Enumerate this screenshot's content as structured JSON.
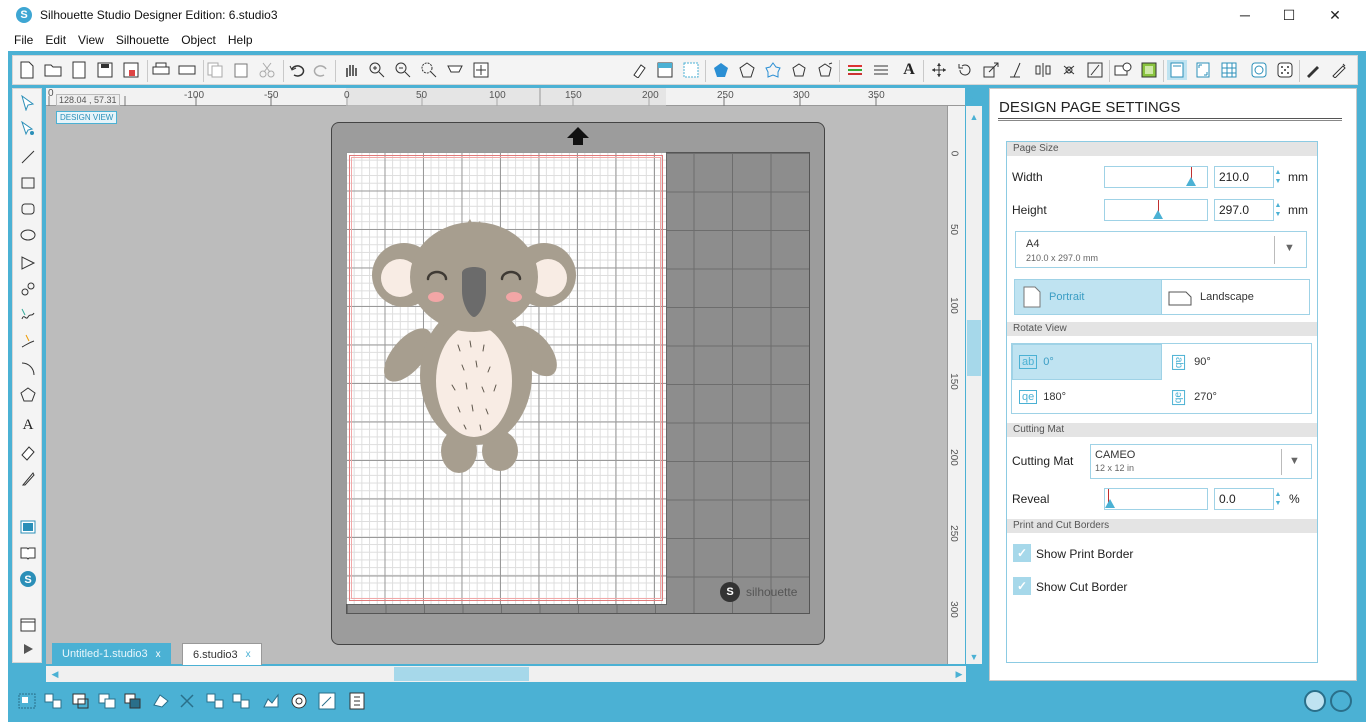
{
  "window": {
    "title": "Silhouette Studio Designer Edition: 6.studio3",
    "logo_letter": "S",
    "minimize": "─",
    "maximize": "☐",
    "close": "✕"
  },
  "menu": [
    "File",
    "Edit",
    "View",
    "Silhouette",
    "Object",
    "Help"
  ],
  "ruler": {
    "coords": "128.04 , 57.31",
    "h_ticks": [
      "0",
      "-100",
      "-50",
      "0",
      "50",
      "100",
      "150",
      "200",
      "250",
      "300",
      "350"
    ],
    "v_ticks": [
      "0",
      "50",
      "100",
      "150",
      "200",
      "250",
      "300"
    ]
  },
  "canvas": {
    "design_view_label": "DESIGN VIEW",
    "brand": "silhouette",
    "brand_logo_letter": "S"
  },
  "tabs": [
    {
      "label": "Untitled-1.studio3",
      "close": "x",
      "active": false
    },
    {
      "label": "6.studio3",
      "close": "x",
      "active": true
    }
  ],
  "panel": {
    "title": "DESIGN PAGE SETTINGS",
    "page_size": {
      "header": "Page Size",
      "width_label": "Width",
      "width_value": "210.0",
      "height_label": "Height",
      "height_value": "297.0",
      "unit": "mm",
      "preset_name": "A4",
      "preset_dims": "210.0 x 297.0 mm",
      "portrait_label": "Portrait",
      "landscape_label": "Landscape",
      "orientation": "Portrait"
    },
    "rotate_view": {
      "header": "Rotate View",
      "options": [
        "0°",
        "90°",
        "180°",
        "270°"
      ],
      "selected": "0°",
      "icon_text": [
        "ab",
        "ab",
        "qe",
        "qe"
      ]
    },
    "cutting_mat": {
      "header": "Cutting Mat",
      "label": "Cutting Mat",
      "mat_name": "CAMEO",
      "mat_size": "12 x 12 in",
      "reveal_label": "Reveal",
      "reveal_value": "0.0",
      "reveal_unit": "%"
    },
    "borders": {
      "header": "Print and Cut Borders",
      "show_print_border_label": "Show Print Border",
      "show_print_border": true,
      "show_cut_border_label": "Show Cut Border",
      "show_cut_border": true,
      "check_glyph": "✓"
    }
  },
  "colors": {
    "accent": "#4bb1d4",
    "accent_light": "#a6d8ea",
    "selected_bg": "#bfe3f1"
  }
}
